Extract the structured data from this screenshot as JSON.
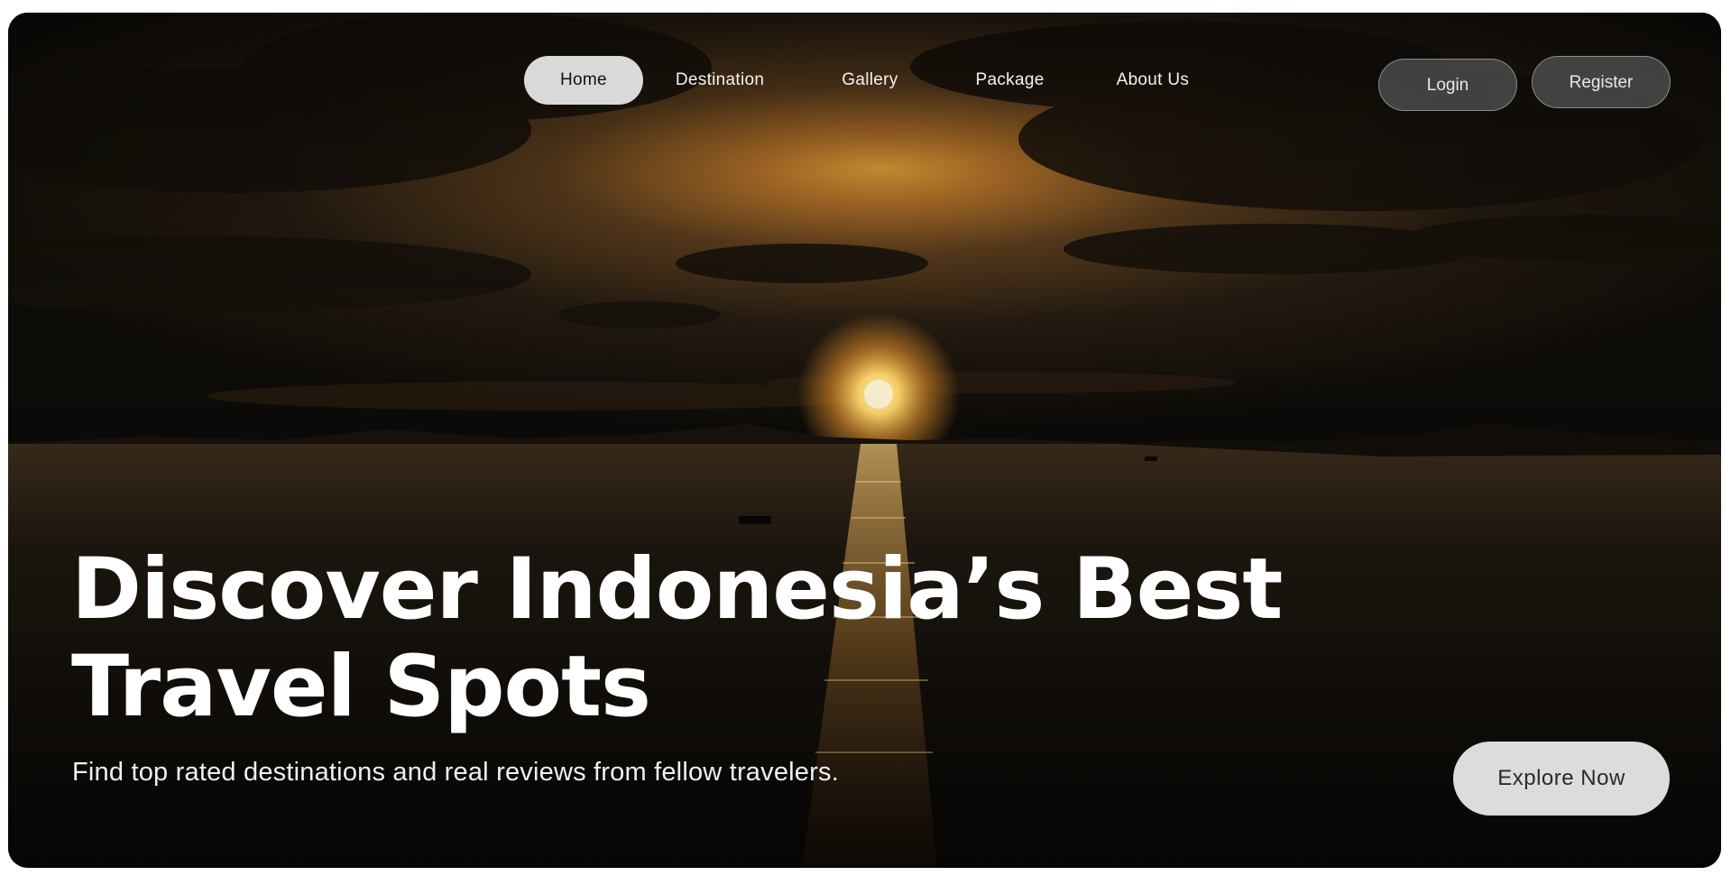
{
  "nav": {
    "links": [
      {
        "label": "Home",
        "active": true
      },
      {
        "label": "Destination",
        "active": false
      },
      {
        "label": "Gallery",
        "active": false
      },
      {
        "label": "Package",
        "active": false
      },
      {
        "label": "About Us",
        "active": false
      }
    ]
  },
  "auth": {
    "login_label": "Login",
    "register_label": "Register"
  },
  "hero": {
    "headline_line1": "Discover Indonesia’s Best",
    "headline_line2": "Travel Spots",
    "subtitle": "Find top rated destinations and real reviews from fellow travelers.",
    "cta_label": "Explore Now",
    "background": "sunset-over-sea-image"
  },
  "colors": {
    "active_pill": "#d9d9d9",
    "auth_button_bg": "#464646",
    "cta_bg": "#dcdcdc",
    "text_light": "#ffffff"
  }
}
